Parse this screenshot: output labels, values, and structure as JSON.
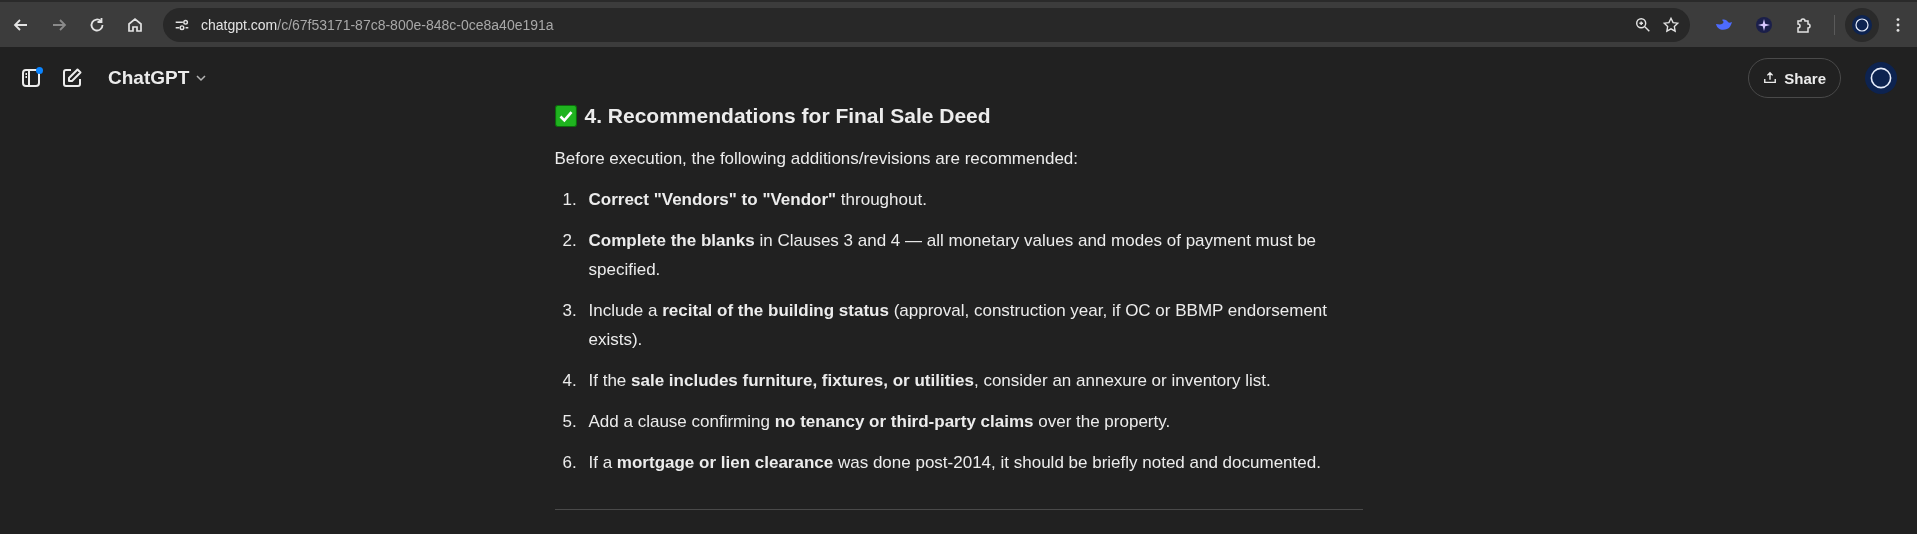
{
  "browser": {
    "url_domain": "chatgpt.com",
    "url_path": "/c/67f53171-87c8-800e-848c-0ce8a40e191a"
  },
  "header": {
    "title": "ChatGPT",
    "share_label": "Share",
    "sidebar_notification": true
  },
  "message": {
    "heading": "4. Recommendations for Final Sale Deed",
    "intro": "Before execution, the following additions/revisions are recommended:",
    "items": [
      {
        "number": "1.",
        "text": "**Correct \"Vendors\" to \"Vendor\"** throughout."
      },
      {
        "number": "2.",
        "text": "**Complete the blanks** in Clauses 3 and 4 — all monetary values and modes of payment must be specified."
      },
      {
        "number": "3.",
        "text": "Include a **recital of the building status** (approval, construction year, if OC or BBMP endorsement exists)."
      },
      {
        "number": "4.",
        "text": "If the **sale includes furniture, fixtures, or utilities**, consider an annexure or inventory list."
      },
      {
        "number": "5.",
        "text": "Add a clause confirming **no tenancy or third-party claims** over the property."
      },
      {
        "number": "6.",
        "text": "If a **mortgage or lien clearance** was done post-2014, it should be briefly noted and documented."
      }
    ]
  }
}
